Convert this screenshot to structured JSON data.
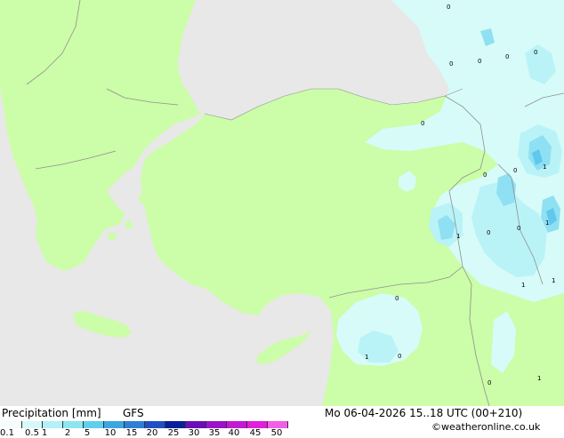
{
  "header": {
    "title": "Precipitation [mm]",
    "model": "GFS",
    "datetime": "Mo 06-04-2026 15..18 UTC (00+210)",
    "credit": "©weatheronline.co.uk"
  },
  "legend": {
    "tick_labels": [
      "0.1",
      "0.5",
      "1",
      "2",
      "5",
      "10",
      "15",
      "20",
      "25",
      "30",
      "35",
      "40",
      "45",
      "50"
    ],
    "colors": [
      "#f5fdfd",
      "#d7f8fb",
      "#b3f1f8",
      "#8ce6f2",
      "#5fcfee",
      "#3aa7e2",
      "#2f7fd6",
      "#1f4fc4",
      "#0a1f9a",
      "#6a0fb8",
      "#9a14c7",
      "#c11ad0",
      "#e01fd8",
      "#f25fe6"
    ]
  },
  "map": {
    "colors": {
      "sea": "#e8e8e8",
      "land": "#ccfda8",
      "light_precip": "#d6fbf9",
      "precip_0_5": "#b9f3f8",
      "precip_1": "#8fe0f2",
      "precip_2": "#5fc8ec",
      "border": "#909090"
    },
    "point_values": [
      "0",
      "0",
      "0",
      "0",
      "0",
      "0",
      "1",
      "0",
      "0",
      "1",
      "0",
      "0",
      "1",
      "1",
      "0",
      "1",
      "0",
      "1",
      "1",
      "0"
    ]
  }
}
